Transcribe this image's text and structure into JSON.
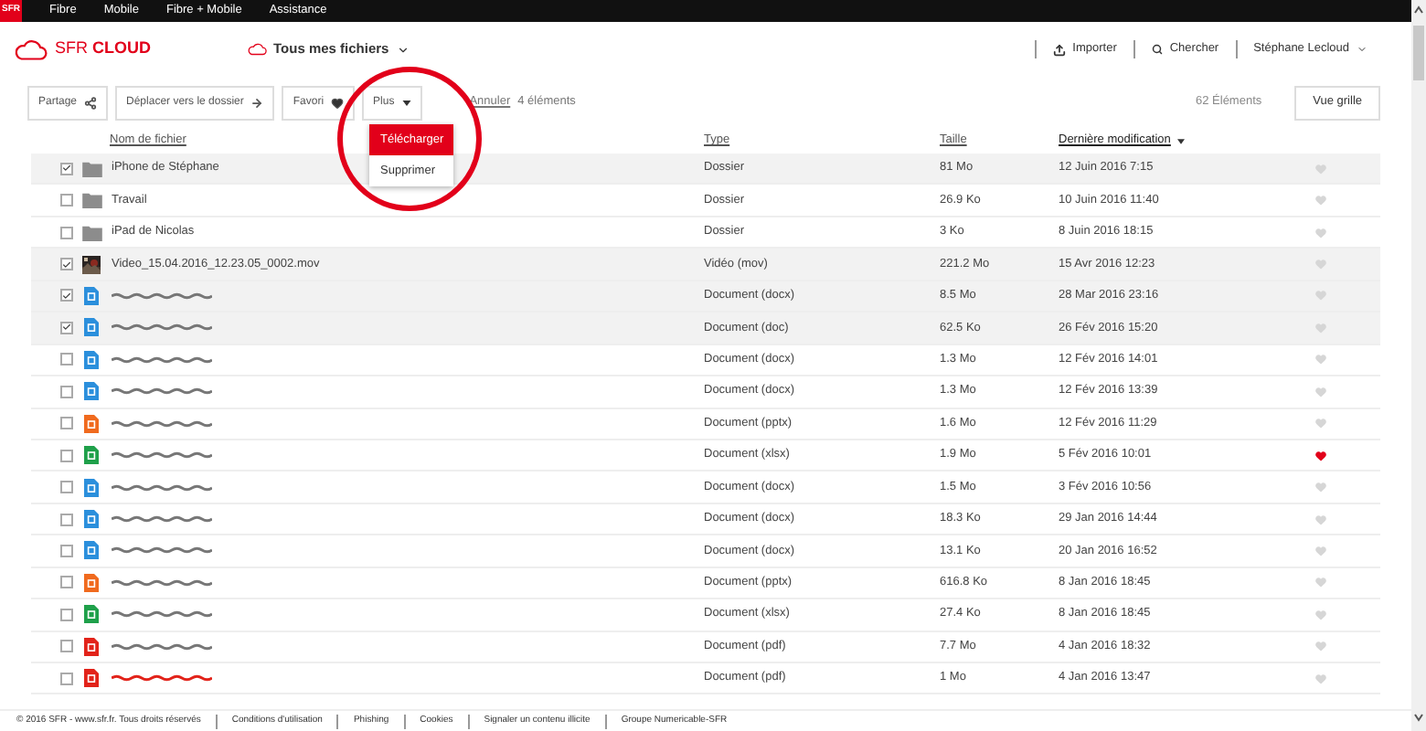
{
  "topnav": {
    "logo": "SFR",
    "items": [
      "Fibre",
      "Mobile",
      "Fibre + Mobile",
      "Assistance"
    ]
  },
  "header": {
    "logo": "SFR **CLOUD**",
    "location": "Tous mes fichiers",
    "actions": [
      "Importer",
      "Chercher"
    ],
    "user": "Stéphane Lecloud"
  },
  "toolbar": {
    "buttons": [
      {
        "label": "Partage",
        "kind": "share"
      },
      {
        "label": "Déplacer vers le dossier",
        "kind": "move"
      },
      {
        "label": "Favori",
        "kind": "favorite"
      },
      {
        "label": "Plus",
        "kind": "more"
      }
    ],
    "cancel": "Annuler",
    "selection_count": "4 éléments",
    "total": "62 Éléments",
    "view_button": "Vue grille"
  },
  "menu": {
    "items": [
      {
        "label": "Télécharger",
        "selected": true
      },
      {
        "label": "Supprimer",
        "selected": false
      }
    ]
  },
  "table": {
    "columns": [
      {
        "label": "Nom de fichier",
        "sorted": false
      },
      {
        "label": "Type",
        "sorted": false
      },
      {
        "label": "Taille",
        "sorted": false
      },
      {
        "label": "Dernière modification",
        "sorted": true
      }
    ],
    "rows": [
      {
        "kind": "folder",
        "name": "iPhone de Stéphane",
        "redacted": false,
        "type": "Dossier",
        "size": "81 Mo",
        "date": "12 Juin 2016 7:15",
        "checked": true,
        "favorite": false
      },
      {
        "kind": "folder",
        "name": "Travail",
        "redacted": false,
        "type": "Dossier",
        "size": "26.9 Ko",
        "date": "10 Juin 2016 11:40",
        "checked": false,
        "favorite": false
      },
      {
        "kind": "folder",
        "name": "iPad de Nicolas",
        "redacted": false,
        "type": "Dossier",
        "size": "3 Ko",
        "date": "8 Juin 2016 18:15",
        "checked": false,
        "favorite": false
      },
      {
        "kind": "video",
        "name": "Video_15.04.2016_12.23.05_0002.mov",
        "redacted": false,
        "type": "Vidéo (mov)",
        "size": "221.2 Mo",
        "date": "15 Avr 2016 12:23",
        "checked": true,
        "favorite": false
      },
      {
        "kind": "word",
        "redacted": true,
        "type": "Document (docx)",
        "size": "8.5 Mo",
        "date": "28 Mar 2016 23:16",
        "checked": true,
        "favorite": false
      },
      {
        "kind": "word",
        "redacted": true,
        "type": "Document (doc)",
        "size": "62.5 Ko",
        "date": "26 Fév 2016 15:20",
        "checked": true,
        "favorite": false
      },
      {
        "kind": "word",
        "redacted": true,
        "type": "Document (docx)",
        "size": "1.3 Mo",
        "date": "12 Fév 2016 14:01",
        "checked": false,
        "favorite": false
      },
      {
        "kind": "word",
        "redacted": true,
        "type": "Document (docx)",
        "size": "1.3 Mo",
        "date": "12 Fév 2016 13:39",
        "checked": false,
        "favorite": false
      },
      {
        "kind": "powerpoint",
        "redacted": true,
        "type": "Document (pptx)",
        "size": "1.6 Mo",
        "date": "12 Fév 2016 11:29",
        "checked": false,
        "favorite": false
      },
      {
        "kind": "excel",
        "redacted": true,
        "type": "Document (xlsx)",
        "size": "1.9 Mo",
        "date": "5 Fév 2016 10:01",
        "checked": false,
        "favorite": true
      },
      {
        "kind": "word",
        "redacted": true,
        "type": "Document (docx)",
        "size": "1.5 Mo",
        "date": "3 Fév 2016 10:56",
        "checked": false,
        "favorite": false
      },
      {
        "kind": "word",
        "redacted": true,
        "type": "Document (docx)",
        "size": "18.3 Ko",
        "date": "29 Jan 2016 14:44",
        "checked": false,
        "favorite": false
      },
      {
        "kind": "word",
        "redacted": true,
        "type": "Document (docx)",
        "size": "13.1 Ko",
        "date": "20 Jan 2016 16:52",
        "checked": false,
        "favorite": false
      },
      {
        "kind": "powerpoint",
        "redacted": true,
        "type": "Document (pptx)",
        "size": "616.8 Ko",
        "date": "8 Jan 2016 18:45",
        "checked": false,
        "favorite": false
      },
      {
        "kind": "excel",
        "redacted": true,
        "type": "Document (xlsx)",
        "size": "27.4 Ko",
        "date": "8 Jan 2016 18:45",
        "checked": false,
        "favorite": false
      },
      {
        "kind": "pdf",
        "redacted": true,
        "type": "Document (pdf)",
        "size": "7.7 Mo",
        "date": "4 Jan 2016 18:32",
        "checked": false,
        "favorite": false
      },
      {
        "kind": "pdf",
        "redacted": true,
        "type": "Document (pdf)",
        "size": "1 Mo",
        "date": "4 Jan 2016 13:47",
        "checked": false,
        "favorite": false
      }
    ]
  },
  "footer": [
    "© 2016 SFR - www.sfr.fr. Tous droits réservés",
    "Conditions d'utilisation",
    "Phishing",
    "Cookies",
    "Signaler un contenu illicite",
    "Groupe Numericable-SFR"
  ]
}
